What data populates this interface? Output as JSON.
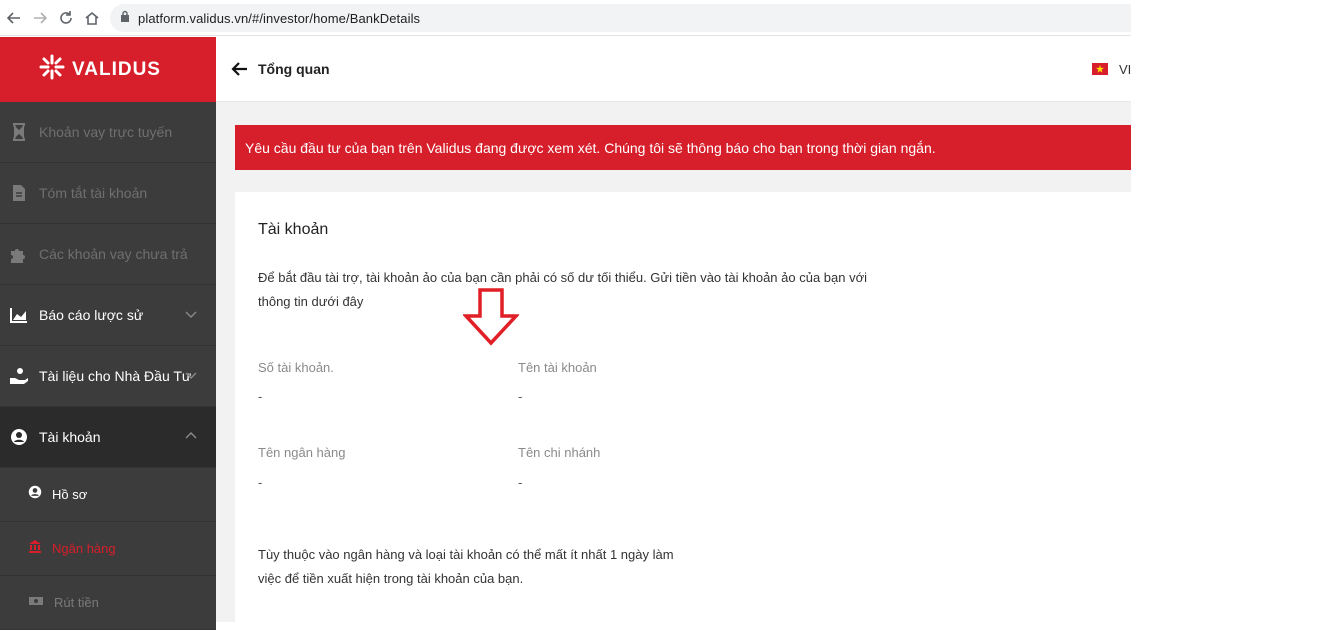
{
  "browser": {
    "url": "platform.validus.vn/#/investor/home/BankDetails"
  },
  "brand": {
    "name": "VALIDUS",
    "color": "#d71f2b"
  },
  "sidebar": {
    "items": [
      {
        "label": "Khoản vay trực tuyến",
        "icon": "hourglass-icon",
        "state": "disabled"
      },
      {
        "label": "Tóm tắt tài khoản",
        "icon": "document-icon",
        "state": "disabled"
      },
      {
        "label": "Các khoản vay chưa trả",
        "icon": "puzzle-icon",
        "state": "disabled"
      },
      {
        "label": "Báo cáo lược sử",
        "icon": "chart-icon",
        "state": "enabled"
      },
      {
        "label": "Tài liệu cho Nhà Đầu Tư",
        "icon": "hand-coin-icon",
        "state": "enabled"
      },
      {
        "label": "Tài khoản",
        "icon": "user-circle-icon",
        "state": "active"
      }
    ],
    "sub_items": [
      {
        "label": "Hồ sơ",
        "icon": "user-circle-icon",
        "state": "enabled"
      },
      {
        "label": "Ngân hàng",
        "icon": "bank-icon",
        "state": "current"
      },
      {
        "label": "Rút tiền",
        "icon": "cash-icon",
        "state": "disabled"
      }
    ]
  },
  "header": {
    "title": "Tổng quan",
    "lang": "VI"
  },
  "alert": {
    "text": "Yêu cầu đầu tư của bạn trên Validus đang được xem xét. Chúng tôi sẽ thông báo cho bạn trong thời gian ngắn."
  },
  "card": {
    "title": "Tài khoản",
    "intro_line1": "Để bắt đầu tài trợ, tài khoản ảo của bạn cần phải có số dư tối thiểu. Gửi tiền vào tài khoản ảo của bạn với",
    "intro_line2": "thông tin dưới đây",
    "fields": {
      "account_number_label": "Số tài khoản.",
      "account_number_value": "-",
      "account_name_label": "Tên tài khoản",
      "account_name_value": "-",
      "bank_name_label": "Tên ngân hàng",
      "bank_name_value": "-",
      "branch_name_label": "Tên chi nhánh",
      "branch_name_value": "-"
    },
    "note_line1": "Tùy thuộc vào ngân hàng và loại tài khoản có thể mất ít nhất 1 ngày làm",
    "note_line2": "việc để tiền xuất hiện trong tài khoản của bạn."
  }
}
